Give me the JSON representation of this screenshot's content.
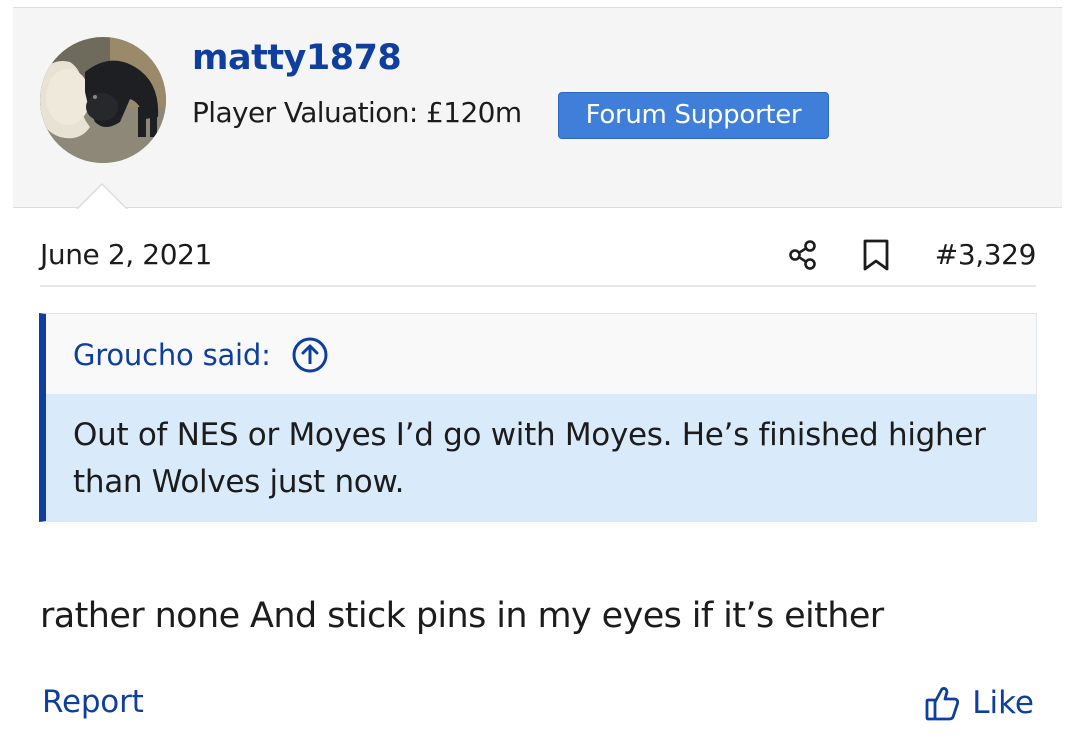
{
  "post": {
    "user": {
      "username": "matty1878",
      "valuation": "Player Valuation: £120m",
      "badge": "Forum Supporter",
      "avatar_icon": "avatar-dogs-photo"
    },
    "date": "June 2, 2021",
    "post_number": "#3,329",
    "quote": {
      "author": "Groucho said:",
      "text": "Out of NES or Moyes I’d go with Moyes. He’s finished higher than Wolves just now."
    },
    "body": "rather none And stick pins in my eyes if it’s either",
    "actions": {
      "report": "Report",
      "like": "Like"
    },
    "icons": {
      "share": "share-icon",
      "bookmark": "bookmark-icon",
      "quote_jump": "arrow-up-circle-icon",
      "like": "thumbs-up-icon"
    },
    "colors": {
      "link": "#0f3f9e",
      "badge": "#3f7ed9",
      "quote_bar": "#0f3f9e",
      "quote_bg": "#d9ebfa",
      "header_bg": "#f5f5f5"
    }
  }
}
